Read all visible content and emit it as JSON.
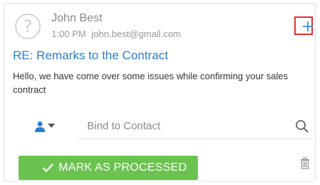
{
  "email": {
    "sender_name": "John Best",
    "time": "1:00 PM",
    "sender_email": "john.best@gmail.com",
    "subject": "RE: Remarks to the Contract",
    "body": "Hello, we have come over some issues while confirming your sales contract",
    "avatar_icon": "question-mark-icon"
  },
  "contact": {
    "type_icon": "person-icon",
    "placeholder": "Bind to Contact",
    "value": ""
  },
  "actions": {
    "add_icon": "plus-icon",
    "mark_processed_label": "MARK AS PROCESSED",
    "delete_icon": "trash-icon"
  },
  "colors": {
    "accent_blue": "#2a7fd4",
    "process_green": "#6bc24f",
    "highlight_red": "#e0302b"
  }
}
